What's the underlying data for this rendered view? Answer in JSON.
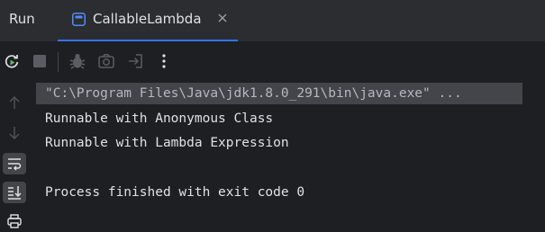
{
  "run_panel": {
    "title": "Run",
    "tab": {
      "label": "CallableLambda",
      "icon": "application-config-icon"
    }
  },
  "toolbar": {
    "buttons": [
      "rerun-icon",
      "stop-icon",
      "debug-icon",
      "screenshot-icon",
      "exit-icon",
      "more-options-icon"
    ]
  },
  "gutter": {
    "buttons": [
      "arrow-up-icon",
      "arrow-down-icon",
      "soft-wrap-icon",
      "scroll-to-end-icon",
      "print-icon"
    ]
  },
  "console": {
    "command_line": "\"C:\\Program Files\\Java\\jdk1.8.0_291\\bin\\java.exe\" ...",
    "output": [
      "Runnable with Anonymous Class",
      "Runnable with Lambda Expression"
    ],
    "exit_message": "Process finished with exit code 0"
  },
  "colors": {
    "background": "#1e1f22",
    "header_background": "#2b2d30",
    "accent": "#3574f0",
    "rerun_green": "#5fb865",
    "text": "#dfe1e5",
    "muted_icon": "#6f737a",
    "command_highlight": "#43454a"
  }
}
